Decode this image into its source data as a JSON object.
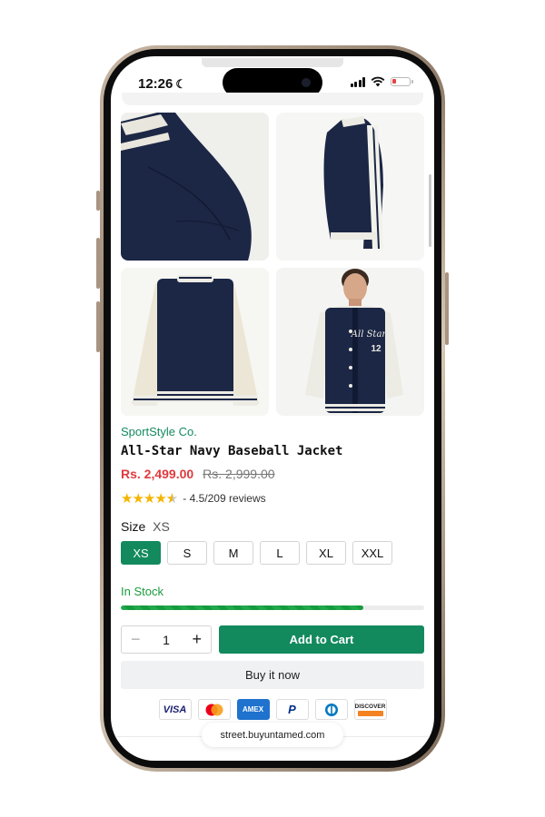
{
  "status_bar": {
    "time": "12:26"
  },
  "product": {
    "brand": "SportStyle Co.",
    "title": "All-Star Navy Baseball Jacket",
    "price": "Rs. 2,499.00",
    "original_price": "Rs. 2,999.00",
    "rating_text": "- 4.5/209 reviews",
    "rating_value": 4.5,
    "images": [
      "shoulder-detail",
      "side-view",
      "back-view",
      "model-front-view"
    ],
    "jacket_lettering": "All Star",
    "jacket_number": "12"
  },
  "size": {
    "label": "Size",
    "selected": "XS",
    "options": [
      "XS",
      "S",
      "M",
      "L",
      "XL",
      "XXL"
    ]
  },
  "stock": {
    "label": "In Stock",
    "level": 0.8
  },
  "quantity": {
    "value": "1",
    "minus": "−",
    "plus": "+"
  },
  "actions": {
    "add_to_cart": "Add to Cart",
    "buy_now": "Buy it now"
  },
  "payments": [
    "VISA",
    "mastercard",
    "AMEX",
    "paypal",
    "diners",
    "DISCOVER"
  ],
  "browser": {
    "url": "street.buyuntamed.com"
  },
  "colors": {
    "accent": "#138a5e",
    "price": "#e03a3e",
    "stock": "#1a9b3c",
    "navy": "#1c2745"
  }
}
